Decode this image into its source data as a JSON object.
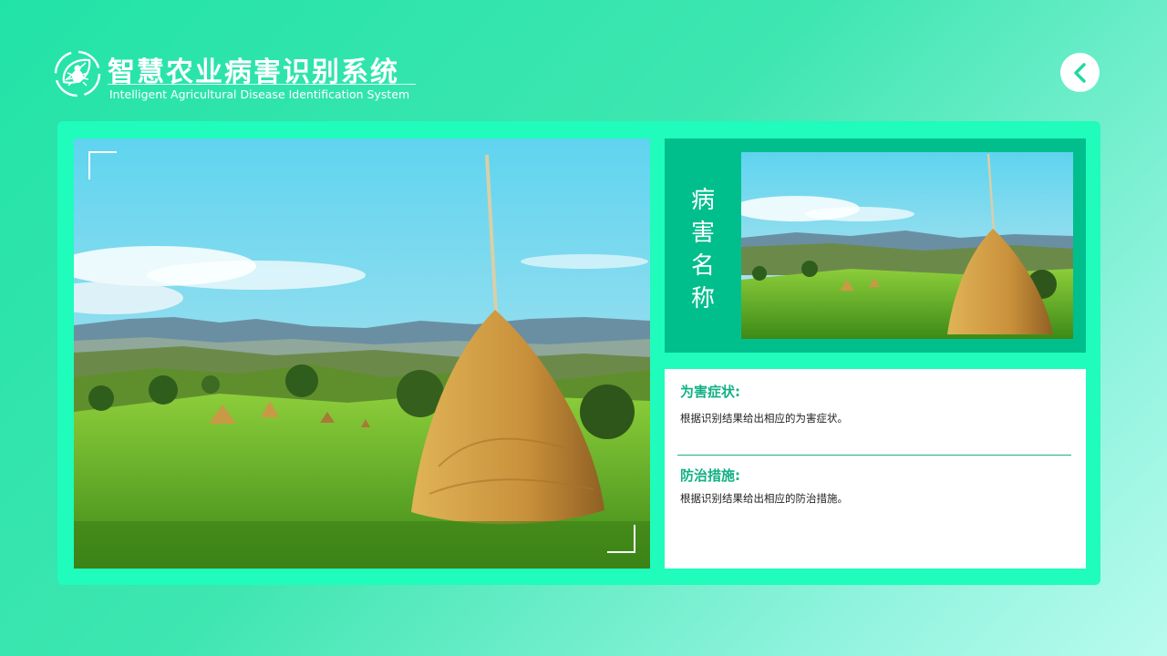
{
  "header": {
    "title_cn": "智慧农业病害识别系统",
    "title_en": "Intelligent Agricultural Disease Identification System",
    "logo_icon": "leaf-bug-logo-icon"
  },
  "nav": {
    "back_icon": "chevron-left-icon"
  },
  "main_image": {
    "subject": "haystack-meadow-photo"
  },
  "result": {
    "name_label": "病害名称",
    "symptoms_title": "为害症状:",
    "symptoms_text": "根据识别结果给出相应的为害症状。",
    "prevention_title": "防治措施:",
    "prevention_text": "根据识别结果给出相应的防治措施。"
  },
  "colors": {
    "panel": "#1ffcbb",
    "name_box": "#00bf8d",
    "accent_text": "#12b184"
  }
}
